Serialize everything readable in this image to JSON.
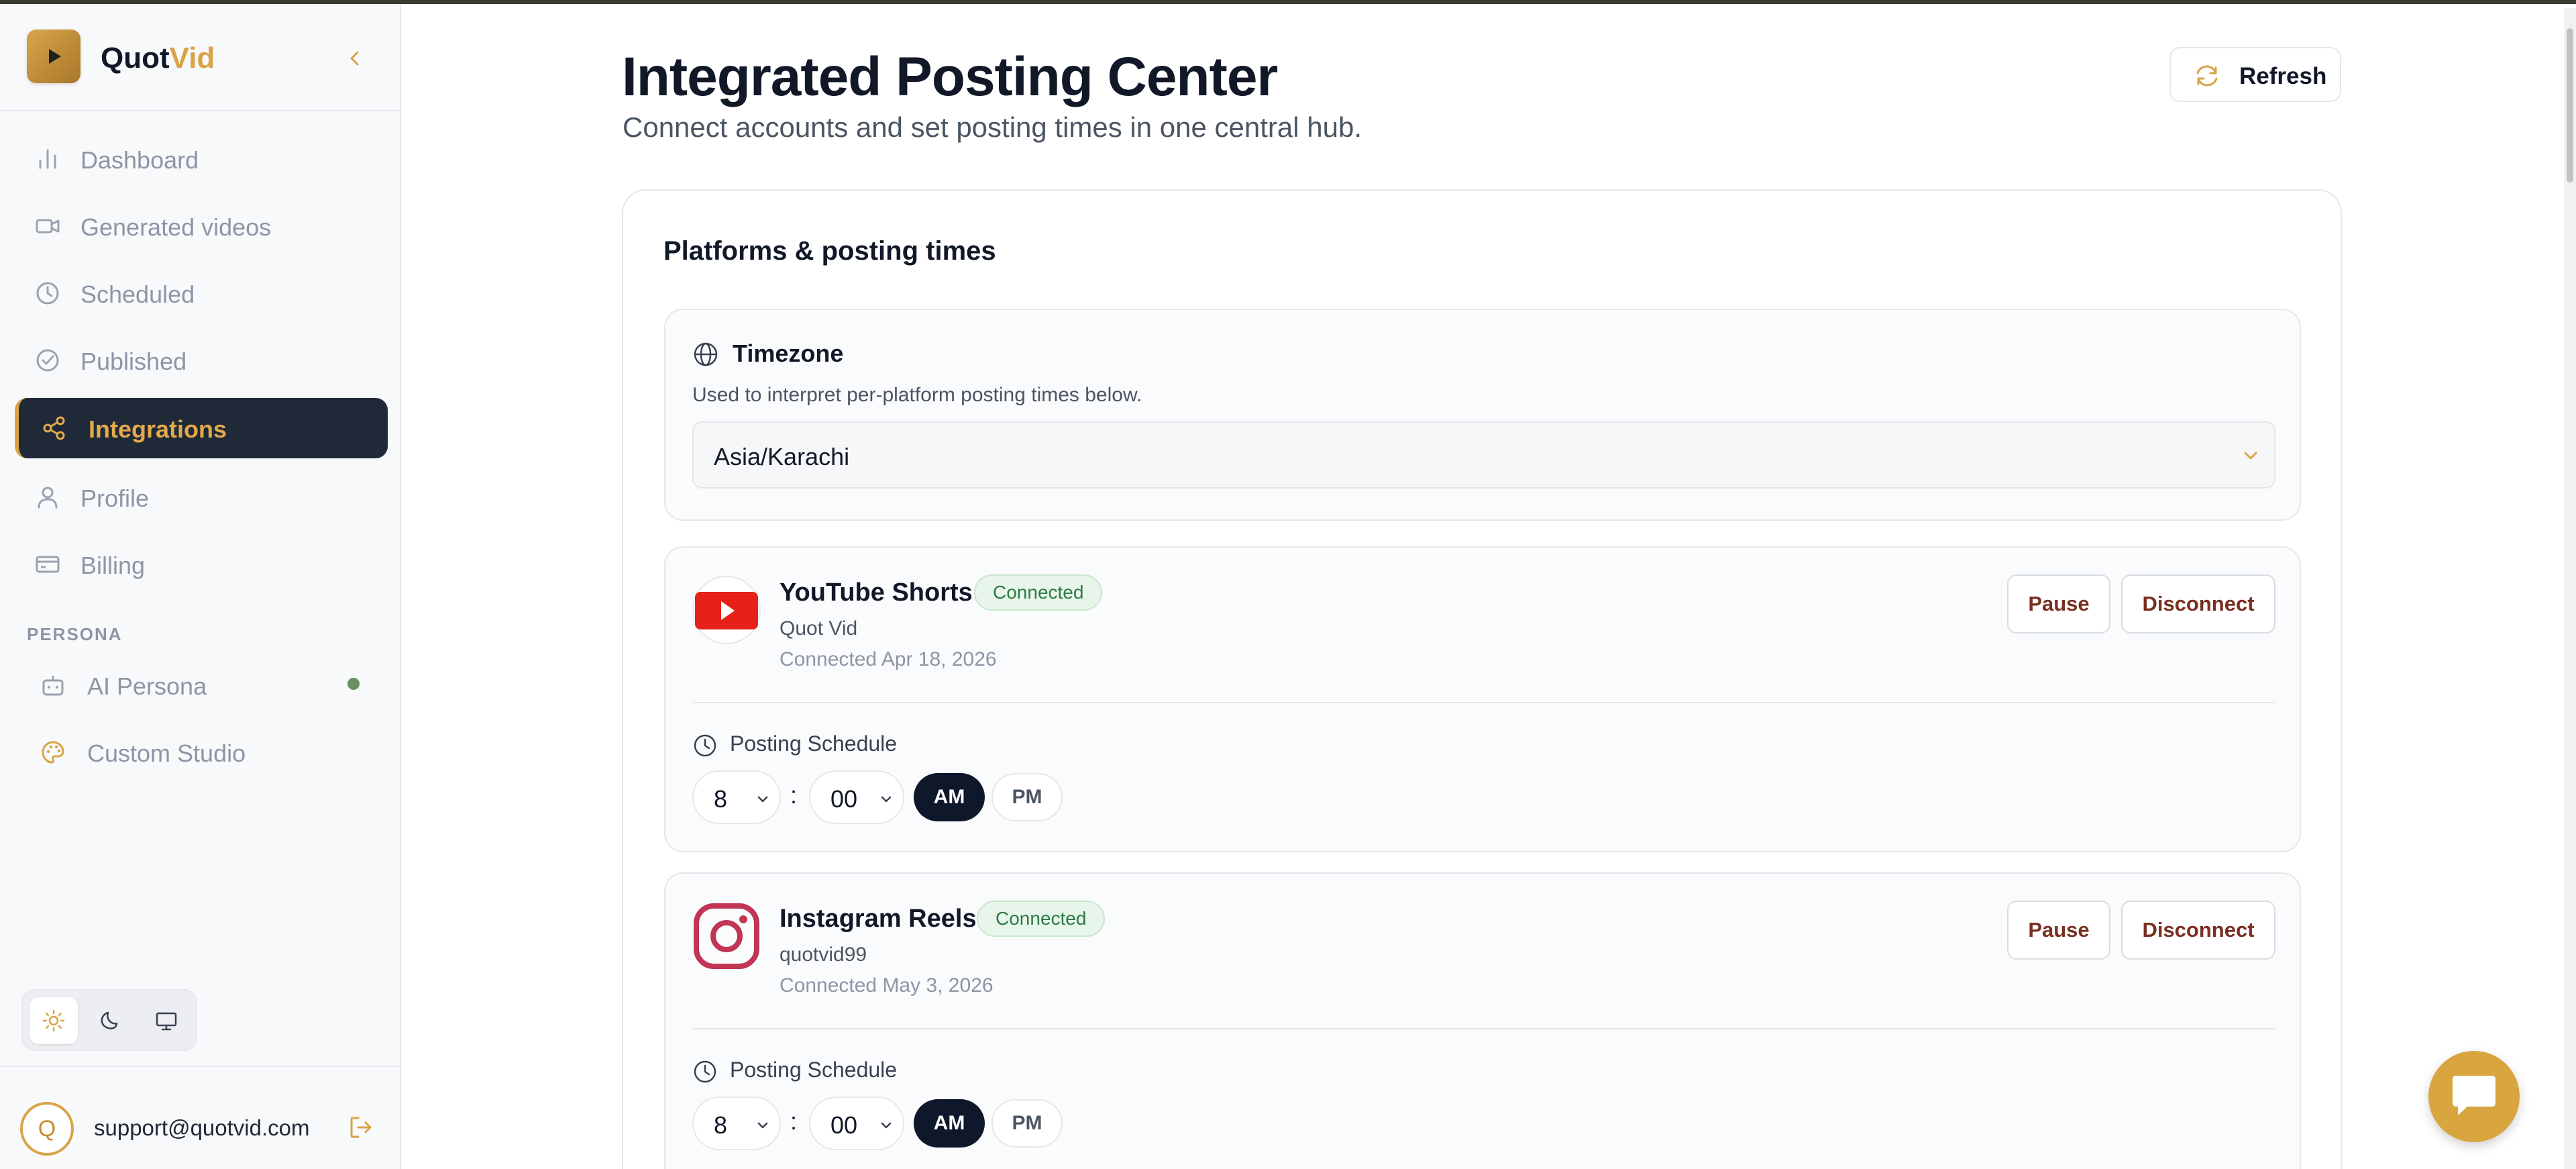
{
  "brand": {
    "name_part1": "Quot",
    "name_part2": "Vid",
    "accent_color": "#d9a345",
    "icons": {
      "logo": "play-icon",
      "collapse": "chevron-left-icon"
    }
  },
  "sidebar": {
    "items": [
      {
        "label": "Dashboard",
        "icon": "bar-chart-icon",
        "active": false
      },
      {
        "label": "Generated videos",
        "icon": "video-camera-icon",
        "active": false
      },
      {
        "label": "Scheduled",
        "icon": "clock-icon",
        "active": false
      },
      {
        "label": "Published",
        "icon": "check-circle-icon",
        "active": false
      },
      {
        "label": "Integrations",
        "icon": "share-icon",
        "active": true
      },
      {
        "label": "Profile",
        "icon": "user-icon",
        "active": false
      },
      {
        "label": "Billing",
        "icon": "credit-card-icon",
        "active": false
      }
    ],
    "persona_heading": "PERSONA",
    "persona_items": [
      {
        "label": "AI Persona",
        "icon": "bot-icon",
        "status": "online"
      },
      {
        "label": "Custom Studio",
        "icon": "palette-icon"
      }
    ],
    "theme_options": [
      "light",
      "dark",
      "system"
    ],
    "theme_selected": "light",
    "user": {
      "avatar_initial": "Q",
      "email": "support@quotvid.com",
      "logout_icon": "logout-icon"
    }
  },
  "header": {
    "title": "Integrated Posting Center",
    "subtitle": "Connect accounts and set posting times in one central hub.",
    "refresh_label": "Refresh"
  },
  "panel": {
    "title": "Platforms & posting times",
    "timezone": {
      "title": "Timezone",
      "description": "Used to interpret per-platform posting times below.",
      "value": "Asia/Karachi"
    },
    "platforms": [
      {
        "name": "YouTube Shorts",
        "status": "Connected",
        "account": "Quot Vid",
        "connected_on": "Connected Apr 18, 2026",
        "pause_label": "Pause",
        "disconnect_label": "Disconnect",
        "schedule_label": "Posting Schedule",
        "hour": "8",
        "minute": "00",
        "am_label": "AM",
        "pm_label": "PM",
        "period_selected": "AM",
        "brand_color": "#e62117"
      },
      {
        "name": "Instagram Reels",
        "status": "Connected",
        "account": "quotvid99",
        "connected_on": "Connected May 3, 2026",
        "pause_label": "Pause",
        "disconnect_label": "Disconnect",
        "schedule_label": "Posting Schedule",
        "hour": "8",
        "minute": "00",
        "am_label": "AM",
        "pm_label": "PM",
        "period_selected": "AM",
        "brand_color": "#c13555"
      }
    ]
  },
  "chat": {
    "icon": "chat-bubble-icon"
  }
}
